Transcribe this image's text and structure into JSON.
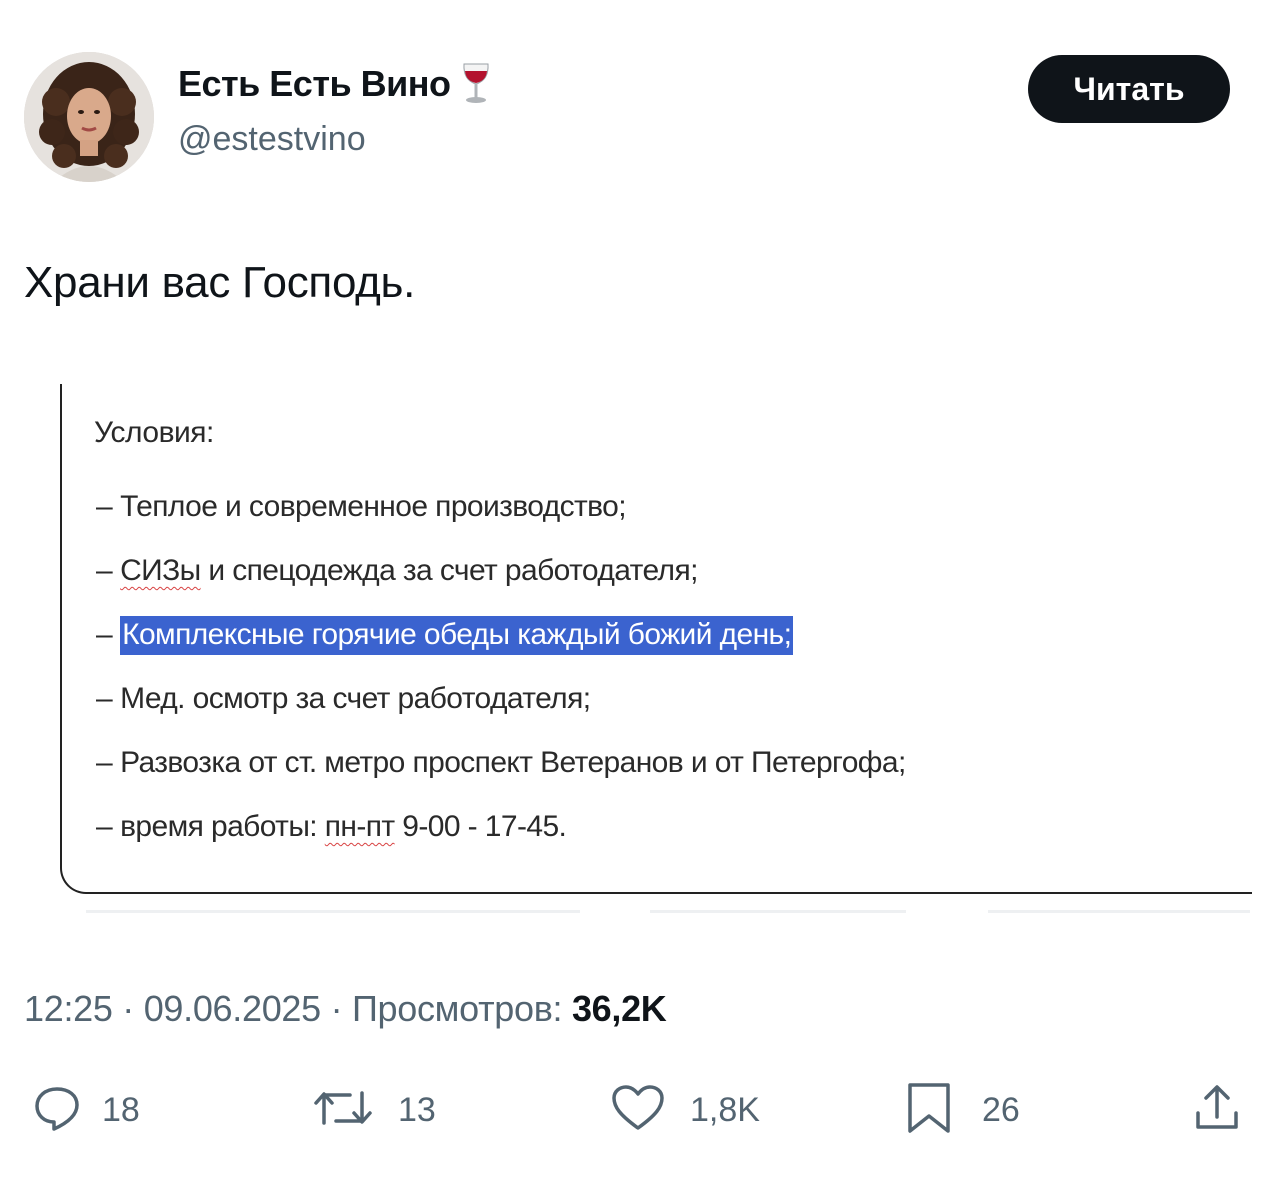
{
  "author": {
    "display_name": "Есть Есть Вино",
    "emoji_icon": "wine-glass-icon",
    "handle": "@estestvino"
  },
  "follow_button": {
    "label": "Читать"
  },
  "tweet": {
    "text": "Храни вас Господь."
  },
  "media": {
    "title": "Условия:",
    "lines": [
      {
        "dash": "–",
        "text": "Теплое и современное производство;"
      },
      {
        "dash": "–",
        "pre": "",
        "underlined": "СИЗы",
        "text": " и спецодежда за счет работодателя;"
      },
      {
        "dash": "–",
        "highlighted": "Комплексные горячие обеды каждый божий день;"
      },
      {
        "dash": "–",
        "text": "Мед. осмотр за счет работодателя;"
      },
      {
        "dash": "–",
        "text": "Развозка от ст. метро проспект Ветеранов и от Петергофа;"
      },
      {
        "dash": "–",
        "pre": "время работы: ",
        "underlined": "пн-пт",
        "text": " 9-00 - 17-45."
      }
    ],
    "highlight_color": "#3b63cf"
  },
  "meta": {
    "time": "12:25",
    "separator": " · ",
    "date": "09.06.2025",
    "views_label": "Просмотров: ",
    "views_count": "36,2K"
  },
  "actions": {
    "replies": "18",
    "reposts": "13",
    "likes": "1,8K",
    "bookmarks": "26"
  },
  "colors": {
    "text": "#0f1419",
    "secondary": "#536471",
    "button_bg": "#0f1419"
  }
}
